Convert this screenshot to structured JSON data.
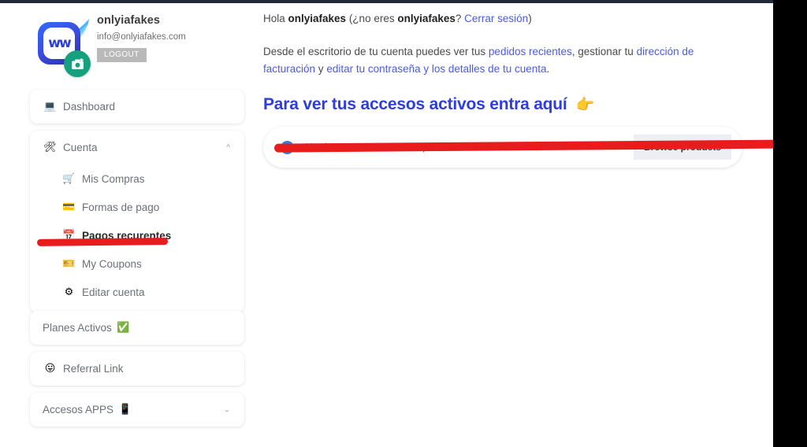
{
  "profile": {
    "name": "onlyiafakes",
    "email": "info@onlyiafakes.com",
    "logout_label": "LOGOUT",
    "logo_glyph": "ww",
    "logo_icon": "logo-mark",
    "camera_icon": "camera-icon",
    "avatar_alt": "avatar"
  },
  "sidebar": {
    "dashboard": {
      "label": "Dashboard",
      "icon": "laptop-icon"
    },
    "account": {
      "label": "Cuenta",
      "icon": "tools-icon",
      "chevron": "chevron-up-icon",
      "expanded": true,
      "items": [
        {
          "label": "Mis Compras",
          "icon": "shopping-cart-icon",
          "active": false
        },
        {
          "label": "Formas de pago",
          "icon": "credit-card-icon",
          "active": false
        },
        {
          "label": "Pagos recurentes",
          "icon": "calendar-icon",
          "active": true
        },
        {
          "label": "My Coupons",
          "icon": "coupon-icon",
          "active": false
        },
        {
          "label": "Editar cuenta",
          "icon": "gear-icon",
          "active": false
        }
      ]
    },
    "planes": {
      "label": "Planes Activos",
      "icon": "check-mark-button-emoji"
    },
    "referral": {
      "label": "Referral Link",
      "icon": "tongue-face-emoji"
    },
    "apps": {
      "label": "Accesos APPS",
      "icon": "mobile-phone-emoji",
      "chevron": "chevron-down-icon"
    }
  },
  "main": {
    "greeting_pre": "Hola ",
    "greeting_user": "onlyiafakes",
    "greeting_mid": " (¿no eres ",
    "greeting_user2": "onlyiafakes",
    "greeting_q": "? ",
    "logout_link": "Cerrar sesión",
    "greeting_close": ")",
    "desc_1": "Desde el escritorio de tu cuenta puedes ver tus ",
    "desc_link_1": "pedidos recientes",
    "desc_2": ", gestionar tu ",
    "desc_link_2": "dirección de facturación",
    "desc_3": " y ",
    "desc_link_3": "editar tu contraseña y los detalles de tu cuenta",
    "desc_4": ".",
    "heading": "Para ver tus accesos activos entra aquí",
    "heading_icon": "pointing-hand-emoji",
    "notice": {
      "icon": "check-circle-icon",
      "text": "You have no active subscriptions.",
      "button": "Browse products"
    }
  },
  "annotations": {
    "sidebar_underline": "red-underline-pagos-recurentes",
    "main_underline": "red-underline-notice"
  },
  "colors": {
    "accent_blue": "#2f3ce0",
    "link_blue": "#4a5ae8",
    "annotation_red": "#e81c1c",
    "badge_green": "#17a07e",
    "top_strip": "#252a3a"
  }
}
